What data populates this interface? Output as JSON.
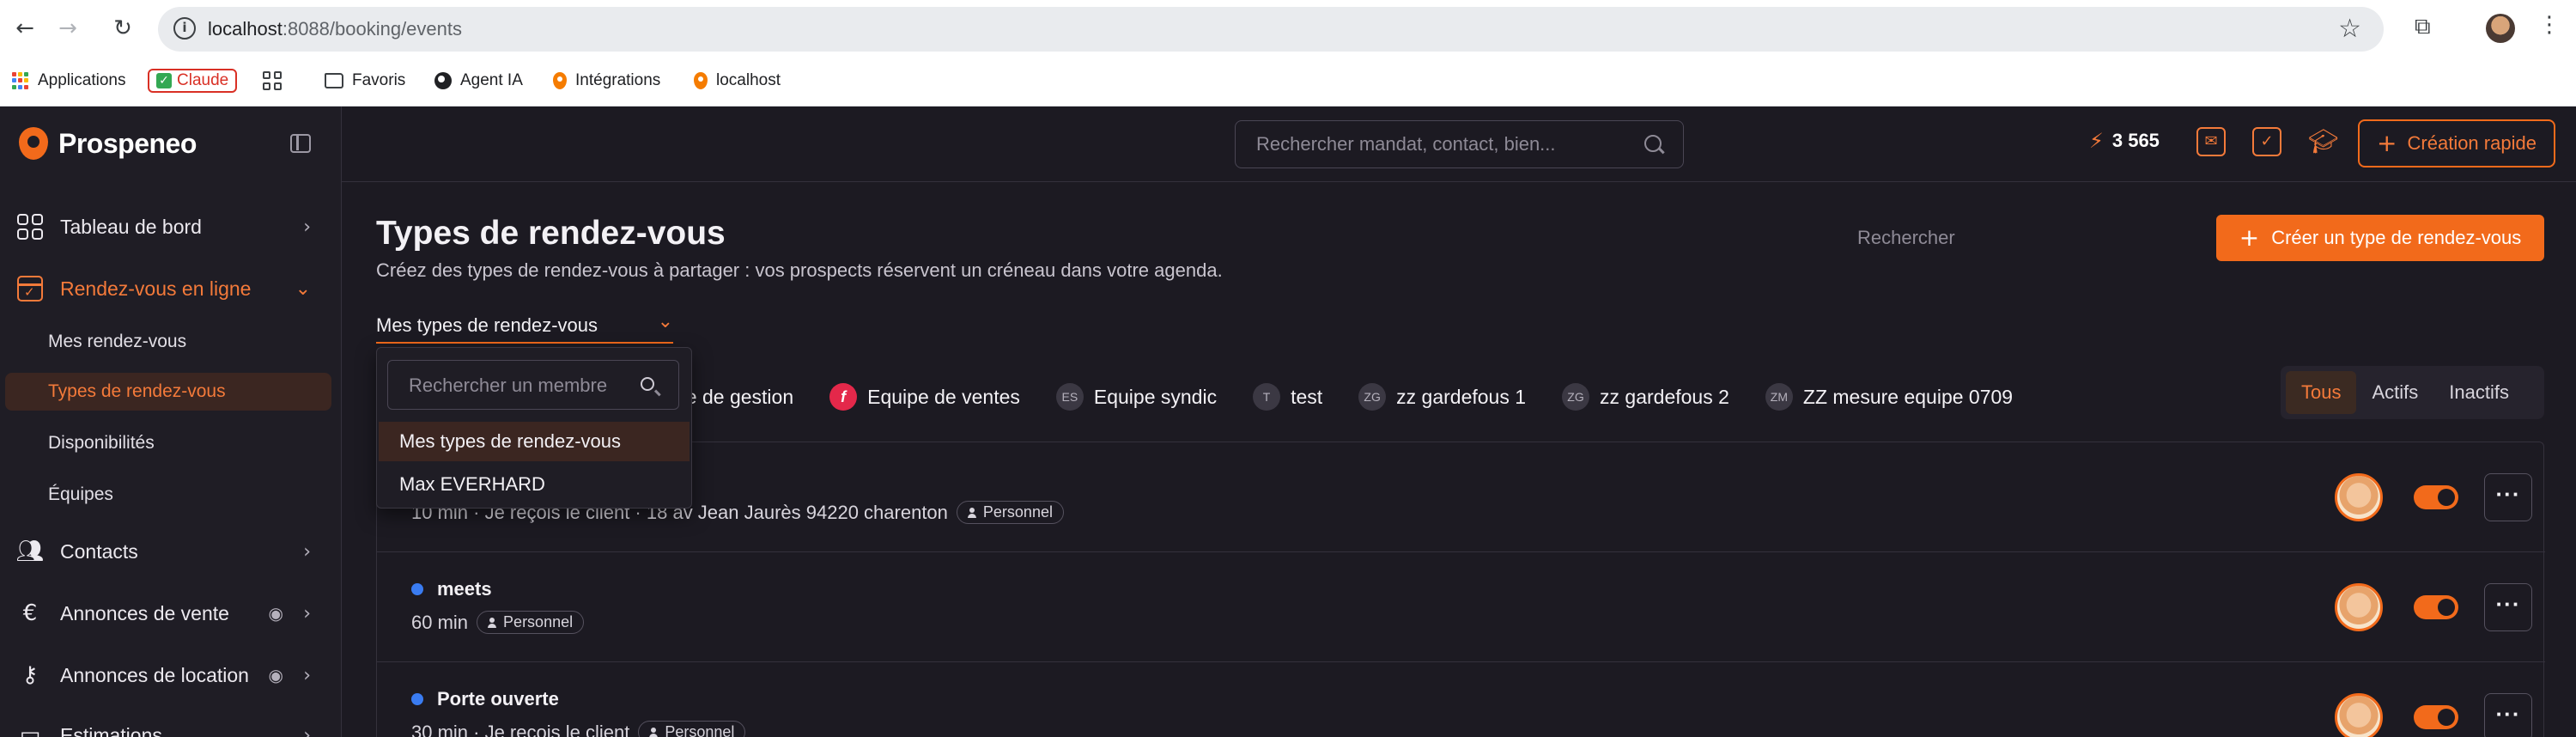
{
  "browser": {
    "url_host": "localhost",
    "url_path": ":8088/booking/events",
    "bookmarks": [
      "Applications",
      "Claude",
      "Favoris",
      "Agent IA",
      "Intégrations",
      "localhost"
    ]
  },
  "sidebar": {
    "brand": "Prospeneo",
    "items": [
      {
        "label": "Tableau de bord"
      },
      {
        "label": "Rendez-vous en ligne"
      },
      {
        "label": "Contacts"
      },
      {
        "label": "Annonces de vente"
      },
      {
        "label": "Annonces de location"
      },
      {
        "label": "Estimations"
      }
    ],
    "sub_items": [
      "Mes rendez-vous",
      "Types de rendez-vous",
      "Disponibilités",
      "Équipes"
    ]
  },
  "header": {
    "search_placeholder": "Rechercher mandat, contact, bien...",
    "credits": "3 565",
    "quick_create": "Création rapide"
  },
  "main": {
    "title": "Types de rendez-vous",
    "subtitle": "Créez des types de rendez-vous à partager : vos prospects réservent un créneau dans votre agenda.",
    "search_label": "Rechercher",
    "create_button": "Créer un type de rendez-vous",
    "filter_value": "Mes types de rendez-vous",
    "teams": [
      {
        "initials": "",
        "name": "pe de gestion"
      },
      {
        "initials": "f",
        "name": "Equipe de ventes"
      },
      {
        "initials": "ES",
        "name": "Equipe syndic"
      },
      {
        "initials": "T",
        "name": "test"
      },
      {
        "initials": "ZG",
        "name": "zz gardefous 1"
      },
      {
        "initials": "ZG",
        "name": "zz gardefous 2"
      },
      {
        "initials": "ZM",
        "name": "ZZ mesure equipe 0709"
      }
    ],
    "status_filter": [
      "Tous",
      "Actifs",
      "Inactifs"
    ],
    "rows": [
      {
        "title": "",
        "meta": "10 min · Je reçois le client · 18 av Jean Jaurès 94220 charenton",
        "badge": "Personnel"
      },
      {
        "title": "meets",
        "meta": "60 min",
        "badge": "Personnel"
      },
      {
        "title": "Porte ouverte",
        "meta": "30 min · Je reçois le client",
        "badge": "Personnel"
      }
    ],
    "more_label": "···"
  },
  "dropdown": {
    "search_placeholder": "Rechercher un membre",
    "options": [
      "Mes types de rendez-vous",
      "Max EVERHARD"
    ]
  },
  "colors": {
    "accent": "#f26a1b",
    "background": "#1c1a22",
    "dot_blue": "#3a7cf2",
    "team_red": "#e4284a"
  }
}
